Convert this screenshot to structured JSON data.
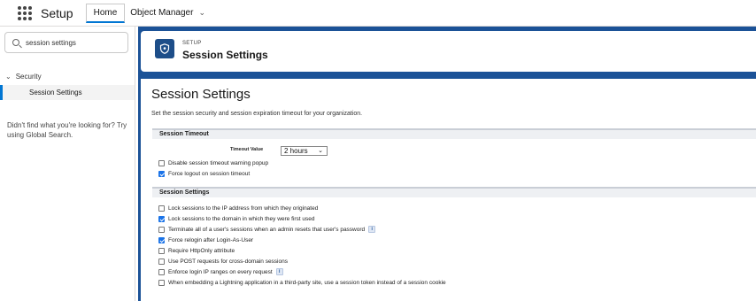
{
  "app": {
    "name": "Setup"
  },
  "tabs": [
    {
      "label": "Home"
    },
    {
      "label": "Object Manager"
    }
  ],
  "sidebar": {
    "search_value": "session settings",
    "group": "Security",
    "item": "Session Settings",
    "help_text": "Didn't find what you're looking for? Try using Global Search."
  },
  "header": {
    "eyebrow": "SETUP",
    "title": "Session Settings"
  },
  "content": {
    "title": "Session Settings",
    "description": "Set the session security and session expiration timeout for your organization.",
    "timeout_section": {
      "title": "Session Timeout",
      "timeout_label": "Timeout Value",
      "timeout_value": "2 hours",
      "checkboxes": [
        {
          "label": "Disable session timeout warning popup",
          "checked": false
        },
        {
          "label": "Force logout on session timeout",
          "checked": true
        }
      ]
    },
    "settings_section": {
      "title": "Session Settings",
      "checkboxes": [
        {
          "label": "Lock sessions to the IP address from which they originated",
          "checked": false,
          "info": false
        },
        {
          "label": "Lock sessions to the domain in which they were first used",
          "checked": true,
          "info": false
        },
        {
          "label": "Terminate all of a user's sessions when an admin resets that user's password",
          "checked": false,
          "info": true
        },
        {
          "label": "Force relogin after Login-As-User",
          "checked": true,
          "info": false
        },
        {
          "label": "Require HttpOnly attribute",
          "checked": false,
          "info": false
        },
        {
          "label": "Use POST requests for cross-domain sessions",
          "checked": false,
          "info": false
        },
        {
          "label": "Enforce login IP ranges on every request",
          "checked": false,
          "info": true
        },
        {
          "label": "When embedding a Lightning application in a third-party site, use a session token instead of a session cookie",
          "checked": false,
          "info": false
        }
      ]
    },
    "info_glyph": "i"
  },
  "colors": {
    "brand_header": "#1b5297",
    "accent": "#0176d3",
    "checkbox": "#1a73e8"
  }
}
